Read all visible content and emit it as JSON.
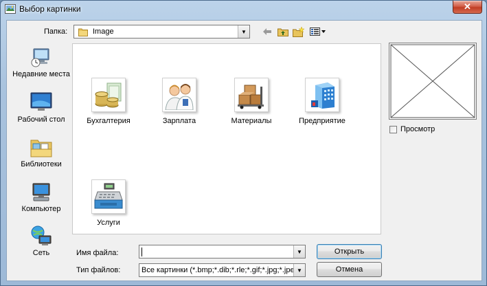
{
  "window": {
    "title": "Выбор картинки",
    "close_label": "✕"
  },
  "toolbar": {
    "folder_label": "Папка:",
    "folder_value": "Image"
  },
  "places": [
    {
      "label": "Недавние места",
      "icon": "recent-places-icon"
    },
    {
      "label": "Рабочий стол",
      "icon": "desktop-icon"
    },
    {
      "label": "Библиотеки",
      "icon": "libraries-icon"
    },
    {
      "label": "Компьютер",
      "icon": "computer-icon"
    },
    {
      "label": "Сеть",
      "icon": "network-icon"
    }
  ],
  "items": [
    {
      "label": "Бухгалтерия",
      "icon": "coins-icon"
    },
    {
      "label": "Зарплата",
      "icon": "people-icon"
    },
    {
      "label": "Материалы",
      "icon": "boxes-icon"
    },
    {
      "label": "Предприятие",
      "icon": "building-icon"
    },
    {
      "label": "Услуги",
      "icon": "cash-register-icon"
    }
  ],
  "preview": {
    "checkbox_label": "Просмотр",
    "checked": false
  },
  "form": {
    "filename_label": "Имя файла:",
    "filename_value": "",
    "filetype_label": "Тип файлов:",
    "filetype_value": "Все картинки (*.bmp;*.dib;*.rle;*.gif;*.jpg;*.jpeg"
  },
  "buttons": {
    "open": "Открыть",
    "cancel": "Отмена"
  }
}
